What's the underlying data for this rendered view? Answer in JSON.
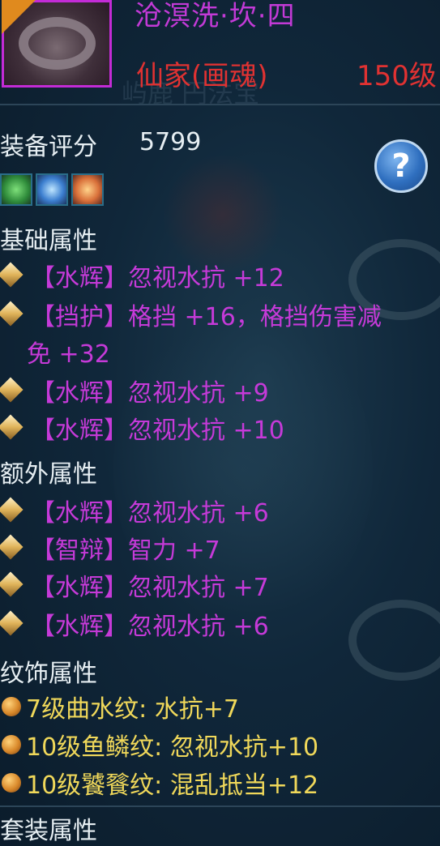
{
  "header": {
    "title": "沧溟洗·坎·四",
    "rank": "仙家(画魂)",
    "level": "150级",
    "ghost_text": "屿鹿 円法宝"
  },
  "score": {
    "label": "装备评分",
    "value": "5799"
  },
  "help": {
    "label": "?"
  },
  "gems": [
    "green-gem-icon",
    "blue-gem-icon",
    "orange-gem-icon"
  ],
  "sections": {
    "basic": "基础属性",
    "extra": "额外属性",
    "pattern": "纹饰属性",
    "set": "套装属性"
  },
  "basic_attrs": [
    "【水辉】忽视水抗 +12",
    "【挡护】格挡 +16，格挡伤害减",
    "免 +32",
    "【水辉】忽视水抗 +9",
    "【水辉】忽视水抗 +10"
  ],
  "extra_attrs": [
    "【水辉】忽视水抗 +6",
    "【智辩】智力 +7",
    "【水辉】忽视水抗 +7",
    "【水辉】忽视水抗 +6"
  ],
  "pattern_attrs": [
    "7级曲水纹: 水抗+7",
    "10级鱼鳞纹: 忽视水抗+10",
    "10级饕餮纹: 混乱抵当+12"
  ],
  "colors": {
    "attr": "#c53ad8",
    "title": "#c23ad6",
    "rank": "#e03232",
    "pattern": "#f0d85a",
    "text": "#e6eef2"
  }
}
